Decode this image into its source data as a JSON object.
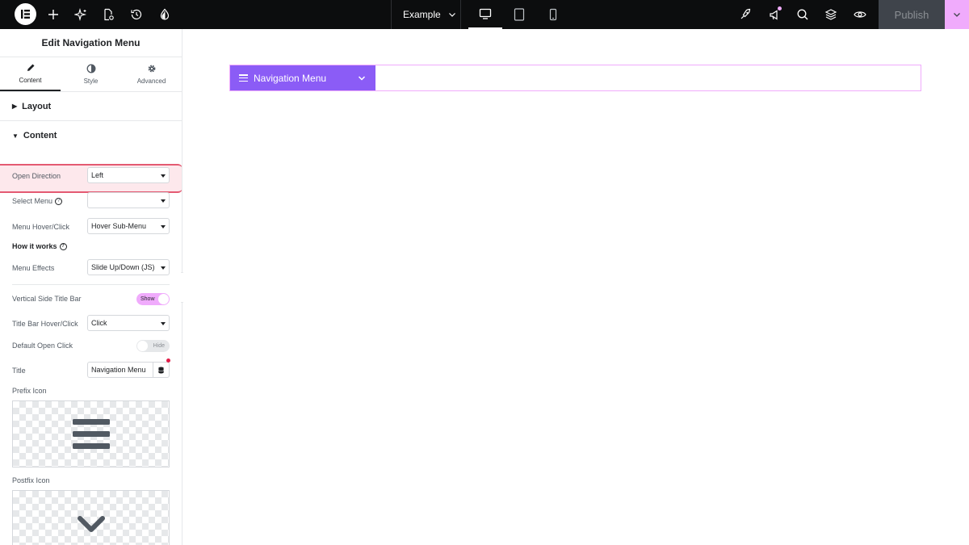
{
  "topbar": {
    "site_name": "Example",
    "publish_label": "Publish",
    "left_icons": [
      "elementor-logo-icon",
      "add-element-icon",
      "ai-sparkle-icon",
      "page-settings-icon",
      "history-icon",
      "site-settings-icon"
    ],
    "device_modes": [
      "desktop-icon",
      "tablet-icon",
      "mobile-icon"
    ],
    "active_device": "desktop",
    "right_icons": [
      "upgrade-rocket-icon",
      "whats-new-megaphone-icon",
      "search-icon",
      "structure-layers-icon",
      "preview-eye-icon"
    ],
    "accent_color": "#f0abfc"
  },
  "panel": {
    "title": "Edit Navigation Menu",
    "tabs": [
      {
        "label": "Content",
        "icon": "pencil-icon",
        "active": true
      },
      {
        "label": "Style",
        "icon": "half-circle-icon",
        "active": false
      },
      {
        "label": "Advanced",
        "icon": "gear-icon",
        "active": false
      }
    ],
    "sections": {
      "layout": "Layout",
      "content": "Content"
    },
    "controls": {
      "open_direction": {
        "label": "Open Direction",
        "value": "Left"
      },
      "select_menu": {
        "label": "Select Menu",
        "value": ""
      },
      "menu_hover_click": {
        "label": "Menu Hover/Click",
        "value": "Hover Sub-Menu"
      },
      "how_it_works": "How it works",
      "menu_effects": {
        "label": "Menu Effects",
        "value": "Slide Up/Down (JS)"
      },
      "vertical_side_title_bar": {
        "label": "Vertical Side Title Bar",
        "toggle": "Show"
      },
      "title_bar_hover_click": {
        "label": "Title Bar Hover/Click",
        "value": "Click"
      },
      "default_open_click": {
        "label": "Default Open Click",
        "toggle": "Hide"
      },
      "title": {
        "label": "Title",
        "value": "Navigation Menu"
      },
      "prefix_icon": {
        "label": "Prefix Icon",
        "icon": "bars-icon"
      },
      "postfix_icon": {
        "label": "Postfix Icon",
        "icon": "chevron-down-icon"
      }
    }
  },
  "canvas": {
    "widget_label": "Navigation Menu",
    "widget_color": "#8b5cf6"
  }
}
